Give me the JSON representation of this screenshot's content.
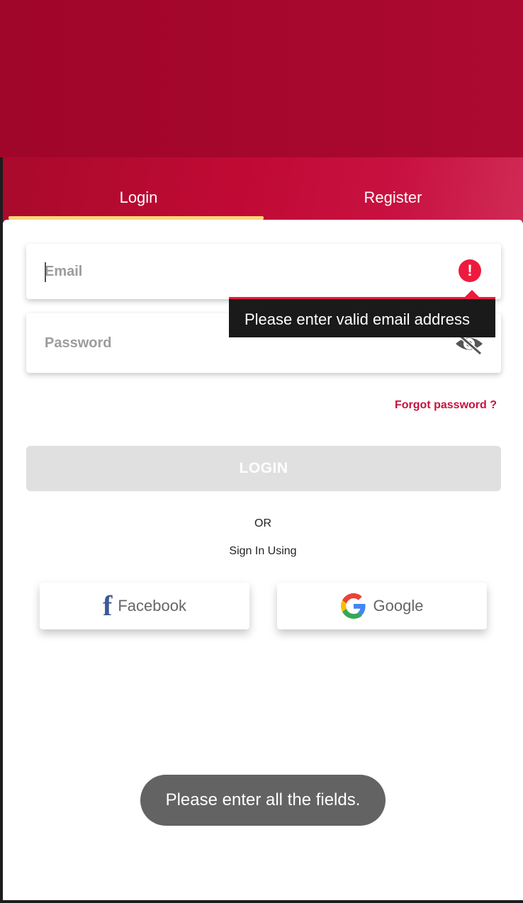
{
  "tabs": {
    "login": "Login",
    "register": "Register"
  },
  "form": {
    "email": {
      "placeholder": "Email",
      "value": ""
    },
    "password": {
      "placeholder": "Password",
      "value": ""
    },
    "email_error": "Please enter valid email address",
    "forgot_password": "Forgot password ?",
    "login_button": "LOGIN"
  },
  "divider": {
    "or": "OR",
    "sign_in_using": "Sign In Using"
  },
  "social": {
    "facebook": "Facebook",
    "google": "Google"
  },
  "toast": "Please enter all the fields.",
  "icons": {
    "error": "error-icon",
    "visibility_off": "eye-off-icon",
    "facebook": "facebook-icon",
    "google": "google-icon"
  },
  "colors": {
    "brand_red": "#a6072c",
    "tab_indicator": "#f7d77a",
    "link": "#c8103e",
    "error": "#ee1a3e",
    "facebook_blue": "#3b5998"
  }
}
